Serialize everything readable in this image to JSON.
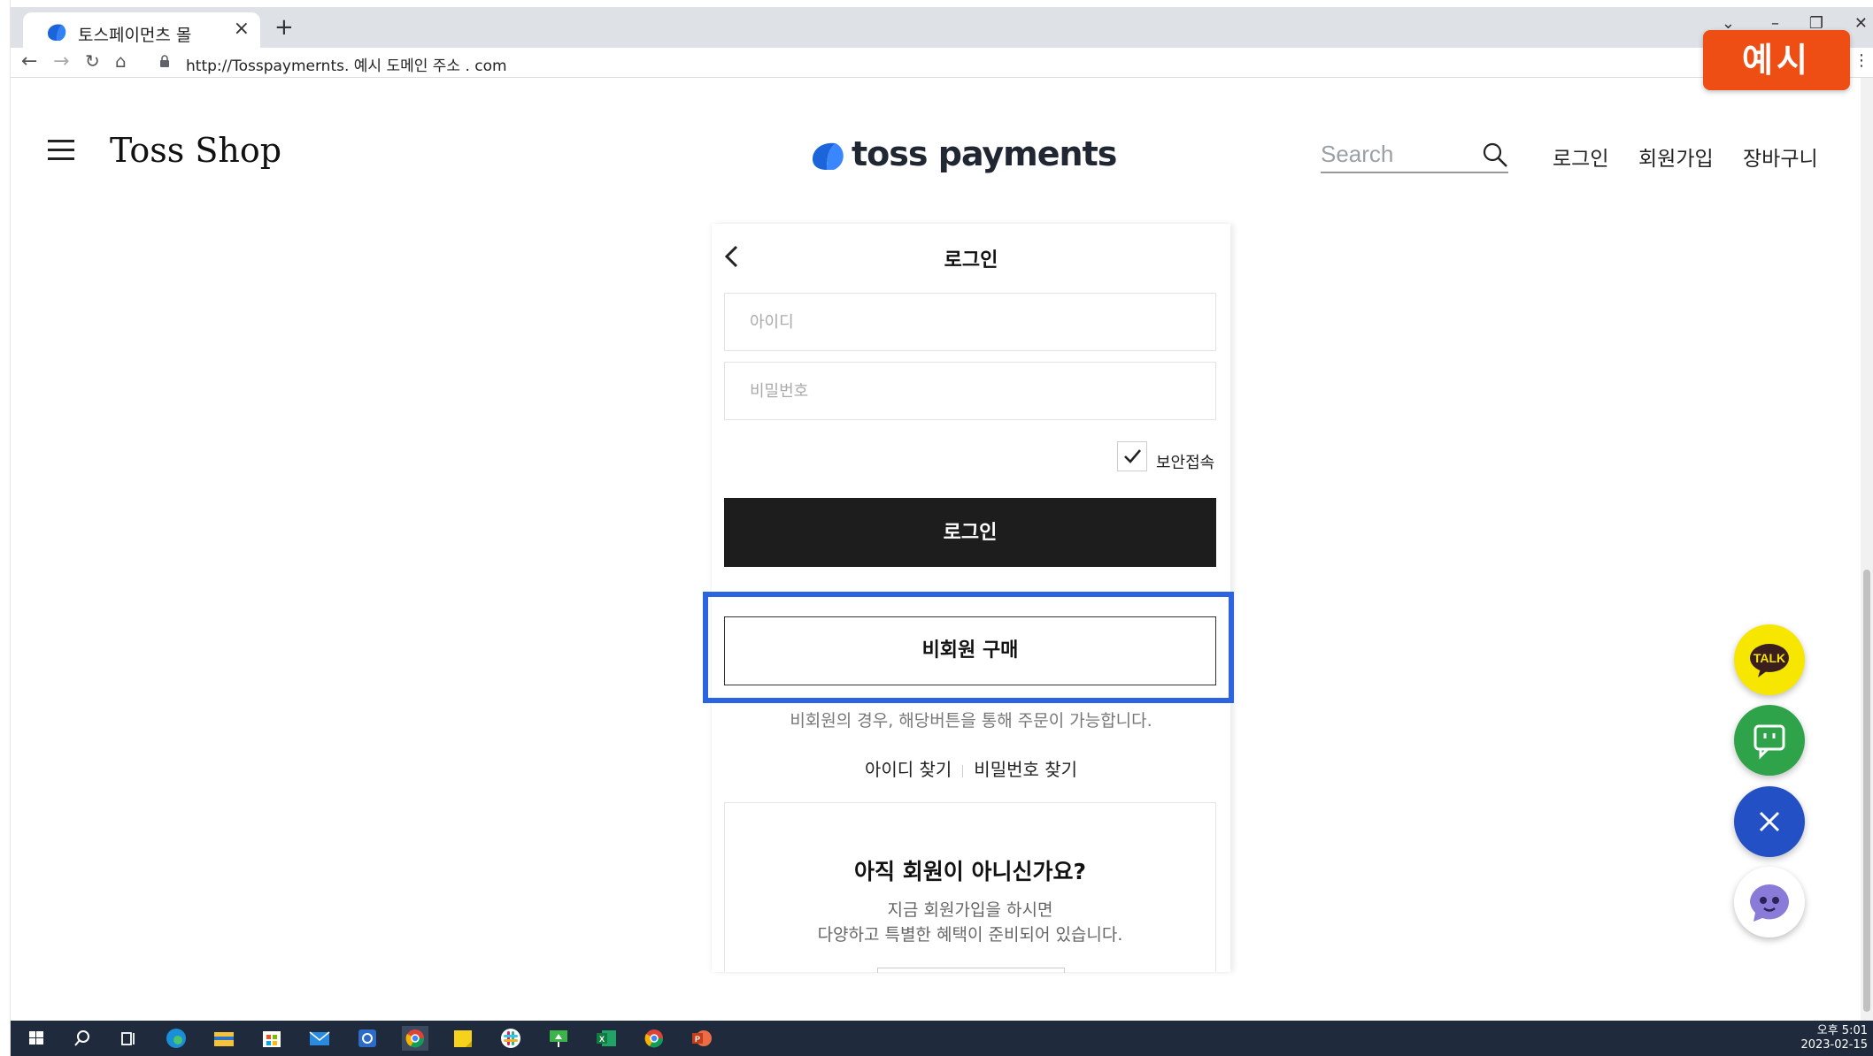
{
  "browser": {
    "tab_title": "토스페이먼츠 몰",
    "tab_close": "×",
    "new_tab": "+",
    "url": "http://Tosspaymernts. 예시 도메인 주소 . com"
  },
  "overlay": {
    "badge": "예시"
  },
  "header": {
    "shop_title": "Toss Shop",
    "logo_text": "toss payments",
    "search_placeholder": "Search",
    "nav": [
      "로그인",
      "회원가입",
      "장바구니"
    ]
  },
  "login": {
    "title": "로그인",
    "id_placeholder": "아이디",
    "password_placeholder": "비밀번호",
    "secure_label": "보안접속",
    "secure_checked": true,
    "login_button": "로그인",
    "guest_button": "비회원 구매",
    "guest_note": "비회원의 경우, 해당버튼을 통해 주문이 가능합니다.",
    "find_id": "아이디 찾기",
    "find_password": "비밀번호 찾기",
    "join_title": "아직 회원이 아니신가요?",
    "join_sub1": "지금 회원가입을 하시면",
    "join_sub2": "다양하고 특별한 혜택이 준비되어 있습니다."
  },
  "floating": {
    "talk_label": "TALK",
    "colors": {
      "talk": "#f7e600",
      "chat": "#2ea34a",
      "close": "#2350c4",
      "bot": "#ffffff"
    }
  },
  "taskbar": {
    "time": "오후 5:01",
    "date": "2023-02-15"
  }
}
